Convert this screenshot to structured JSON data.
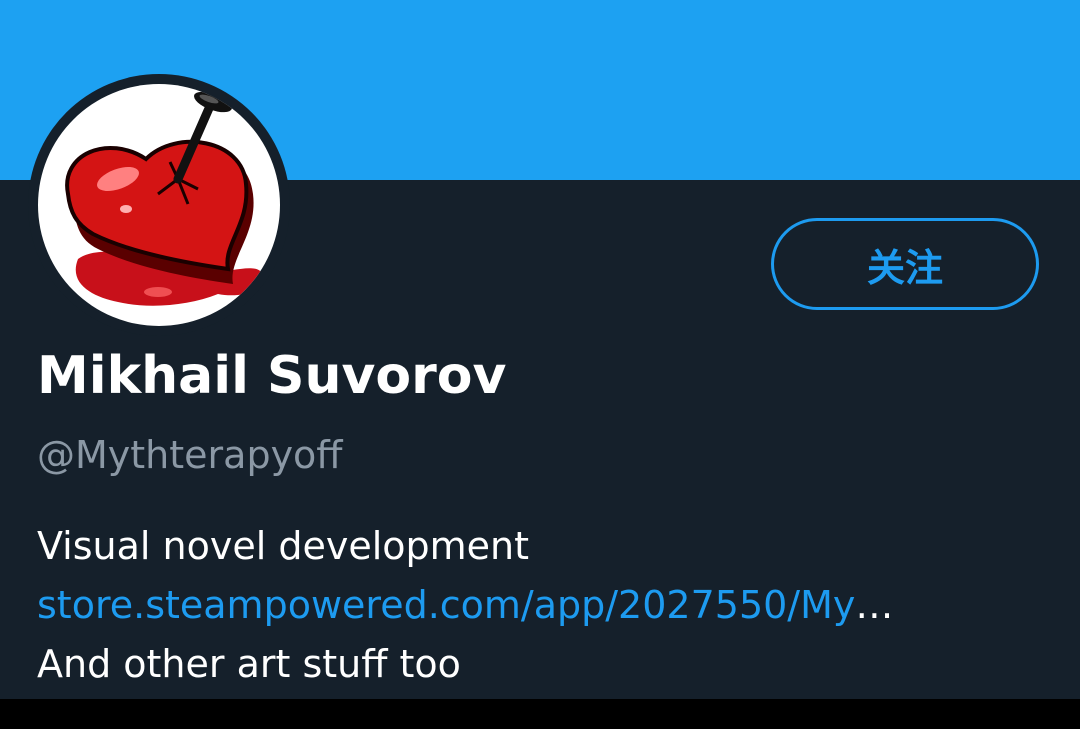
{
  "colors": {
    "banner": "#1da1f2",
    "background": "#15202b",
    "accent": "#1d9bf0",
    "handle": "#8b98a5",
    "text": "#ffffff"
  },
  "profile": {
    "avatar_icon": "heart-pierced-by-nail-icon",
    "follow_label": "关注",
    "display_name": "Mikhail Suvorov",
    "handle": "@Mythterapyoff",
    "bio": {
      "line1": "Visual novel development",
      "link_text": "store.steampowered.com/app/2027550/My",
      "link_ellipsis": "…",
      "line3": "And other art stuff too"
    }
  }
}
